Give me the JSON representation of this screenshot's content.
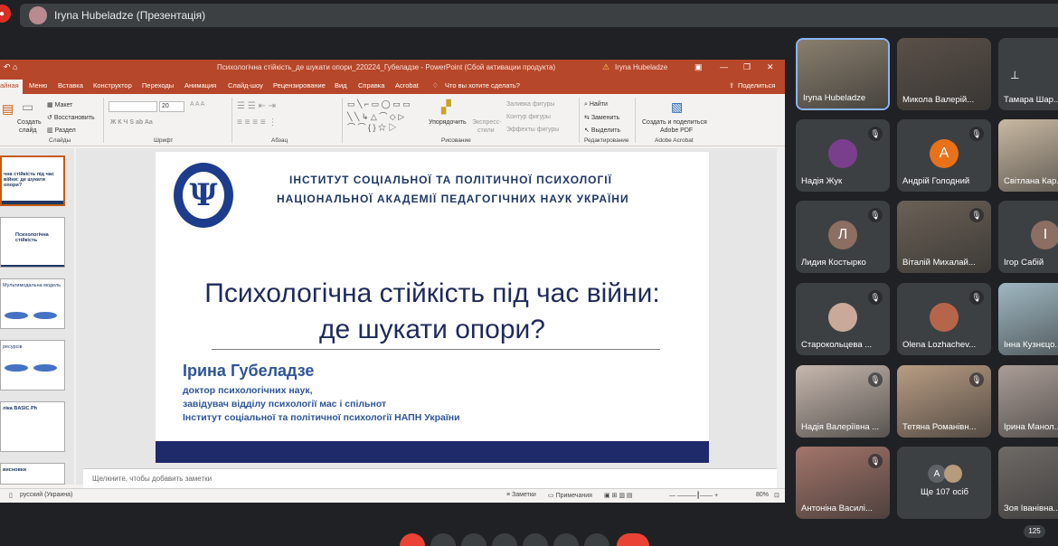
{
  "meet": {
    "presenter_chip": "Iryna Hubeladze (Презентація)",
    "participant_count": "125",
    "more_label": "Ще 107 осіб"
  },
  "ppt": {
    "doc_title": "Психологічна стійкість_де шукати опори_220224_Губеладзе  -  PowerPoint (Сбой активации продукта)",
    "user": "Iryna Hubeladze",
    "tabs": [
      "айная",
      "Меню",
      "Вставка",
      "Конструктор",
      "Переходы",
      "Анимация",
      "Слайд-шоу",
      "Рецензирование",
      "Вид",
      "Справка",
      "Acrobat",
      "Что вы хотите сделать?"
    ],
    "share": "Поделиться",
    "ribbon": {
      "create_slide_1": "Создать",
      "create_slide_2": "слайд",
      "layout": "Макет",
      "restore": "Восстановить",
      "section": "Раздел",
      "grp_slides": "Слайды",
      "grp_font": "Шрифт",
      "grp_para": "Абзац",
      "grp_draw": "Рисование",
      "grp_edit": "Редактирование",
      "grp_acrobat": "Adobe Acrobat",
      "font_size": "20",
      "arrange": "Упорядочить",
      "express_1": "Экспресс-",
      "express_2": "стили",
      "fill": "Заливка фигуры",
      "outline": "Контур фигуры",
      "effects": "Эффекты фигуры",
      "find": "Найти",
      "replace": "Заменить",
      "select": "Выделить",
      "adobe_1": "Создать и поделиться",
      "adobe_2": "Adobe PDF"
    },
    "notes_placeholder": "Щелкните, чтобы добавить заметки",
    "status_lang": "русский (Украина)",
    "status_notes": "Заметки",
    "status_comments": "Примечания",
    "zoom": "80%"
  },
  "slide": {
    "institute_line1": "ІНСТИТУТ СОЦІАЛЬНОЇ ТА ПОЛІТИЧНОЇ ПСИХОЛОГІЇ",
    "institute_line2": "НАЦІОНАЛЬНОЇ АКАДЕМІЇ ПЕДАГОГІЧНИХ НАУК УКРАЇНИ",
    "logo_symbol": "Ψ",
    "title_line1": "Психологічна стійкість під час війни:",
    "title_line2": "де шукати опори?",
    "author": "Ірина Губеладзе",
    "role1": "доктор психологічних наук,",
    "role2": "завідувач відділу психології мас і спільнот",
    "role3": "Інститут соціальної та політичної психології НАПН України"
  },
  "thumbnails": [
    {
      "text": "чна стійкість під час війни: де шукати опори?"
    },
    {
      "text": "Психологічна стійкість"
    },
    {
      "text": "Мультимодальна модель"
    },
    {
      "text": "ресурсів"
    },
    {
      "text": "ліка BASIC Ph"
    },
    {
      "text": "висновки"
    }
  ],
  "participants": [
    {
      "name": "Iryna Hubeladze",
      "initial": "",
      "color": "#8a7f6e"
    },
    {
      "name": "Микола Валерій...",
      "initial": "",
      "color": "#5a5048"
    },
    {
      "name": "Тамара Шар...",
      "initial": "",
      "color": "#3c4043"
    },
    {
      "name": "Надія Жук",
      "initial": "",
      "color": "#7a3f8c"
    },
    {
      "name": "Андрій Голодний",
      "initial": "A",
      "color": "#e8711a"
    },
    {
      "name": "Світлана Кар...",
      "initial": "",
      "color": "#c9b9a2"
    },
    {
      "name": "Лидия Костырко",
      "initial": "Л",
      "color": "#8d6e63"
    },
    {
      "name": "Віталій Михалай...",
      "initial": "",
      "color": "#6b6156"
    },
    {
      "name": "Ігор Сабій",
      "initial": "І",
      "color": "#8d6e63"
    },
    {
      "name": "Старокольцева ...",
      "initial": "",
      "color": "#c9a99a"
    },
    {
      "name": "Olena Lozhachev...",
      "initial": "",
      "color": "#b5654a"
    },
    {
      "name": "Інна Кузнєцо...",
      "initial": "",
      "color": "#9fb8c2"
    },
    {
      "name": "Надія Валеріївна ...",
      "initial": "",
      "color": "#c7b8ae"
    },
    {
      "name": "Тетяна Романівн...",
      "initial": "",
      "color": "#b99d83"
    },
    {
      "name": "Ірина Манол...",
      "initial": "",
      "color": "#ab9d96"
    },
    {
      "name": "Антоніна Василі...",
      "initial": "",
      "color": "#a3756a"
    },
    {
      "name": "",
      "initial": "",
      "color": "#3c4043"
    },
    {
      "name": "Зоя Іванівна...",
      "initial": "",
      "color": "#6e6a66"
    }
  ]
}
